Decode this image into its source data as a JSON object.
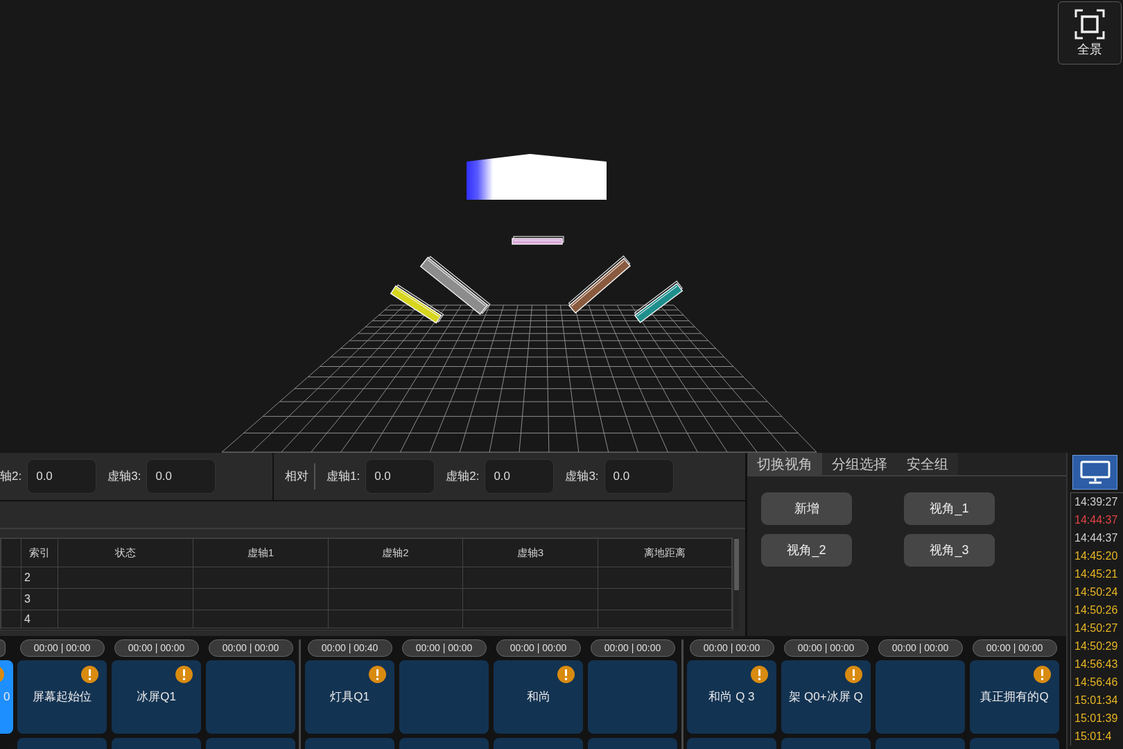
{
  "viewport": {
    "fixtures": [
      {
        "color": "#d6d61e"
      },
      {
        "color": "#8c8c8c"
      },
      {
        "color": "#d9a3d9"
      },
      {
        "color": "#8a5a3e"
      },
      {
        "color": "#1f8f8c"
      }
    ],
    "fullview_button": {
      "label": "全景"
    }
  },
  "axis_toolbar": {
    "sections": [
      {
        "fields": [
          {
            "label": "轴2:",
            "value": "0.0"
          },
          {
            "label": "虚轴3:",
            "value": "0.0"
          }
        ]
      },
      {
        "title": "相对",
        "fields": [
          {
            "label": "虚轴1:",
            "value": "0.0"
          },
          {
            "label": "虚轴2:",
            "value": "0.0"
          },
          {
            "label": "虚轴3:",
            "value": "0.0"
          }
        ]
      }
    ]
  },
  "table": {
    "columns": [
      "索引",
      "状态",
      "虚轴1",
      "虚轴2",
      "虚轴3",
      "离地距离"
    ],
    "rows": [
      {
        "index": "2"
      },
      {
        "index": "3"
      },
      {
        "index": "4"
      }
    ]
  },
  "view_panel": {
    "tabs": [
      {
        "label": "切换视角",
        "selected": true
      },
      {
        "label": "分组选择",
        "selected": false
      },
      {
        "label": "安全组",
        "selected": false
      }
    ],
    "buttons": [
      "新增",
      "视角_1",
      "视角_2",
      "视角_3"
    ]
  },
  "cues": {
    "groups": [
      {
        "columns": [
          {
            "kind": "partial",
            "tiles": [
              {
                "label": "0",
                "warning": true,
                "selected": true
              }
            ]
          },
          {
            "kind": "full",
            "time": "00:00 | 00:00",
            "tiles": [
              {
                "label": "屏幕起始位",
                "warning": true,
                "selected": false
              },
              {
                "warning": false,
                "selected": false
              }
            ]
          },
          {
            "kind": "full",
            "time": "00:00 | 00:00",
            "tiles": [
              {
                "label": "冰屏Q1",
                "warning": true,
                "selected": false
              },
              {
                "warning": false,
                "selected": false
              }
            ]
          },
          {
            "kind": "full",
            "time": "00:00 | 00:00",
            "tiles": [
              {
                "warning": false,
                "selected": false
              },
              {
                "warning": false,
                "selected": false
              }
            ]
          }
        ]
      },
      {
        "columns": [
          {
            "kind": "full",
            "time": "00:00 | 00:40",
            "tiles": [
              {
                "label": "灯具Q1",
                "warning": true,
                "selected": false
              },
              {
                "warning": false,
                "selected": false
              }
            ]
          },
          {
            "kind": "full",
            "time": "00:00 | 00:00",
            "tiles": [
              {
                "warning": false,
                "selected": false
              },
              {
                "warning": false,
                "selected": false
              }
            ]
          },
          {
            "kind": "full",
            "time": "00:00 | 00:00",
            "tiles": [
              {
                "label": "和尚",
                "warning": true,
                "selected": false
              },
              {
                "warning": false,
                "selected": false
              }
            ]
          },
          {
            "kind": "full",
            "time": "00:00 | 00:00",
            "tiles": [
              {
                "warning": false,
                "selected": false
              },
              {
                "warning": false,
                "selected": false
              }
            ]
          }
        ]
      },
      {
        "columns": [
          {
            "kind": "full",
            "time": "00:00 | 00:00",
            "tiles": [
              {
                "label": "和尚 Q 3",
                "warning": true,
                "selected": false
              },
              {
                "warning": false,
                "selected": false
              }
            ]
          },
          {
            "kind": "full",
            "time": "00:00 | 00:00",
            "tiles": [
              {
                "label": "架 Q0+冰屏 Q",
                "warning": true,
                "selected": false
              },
              {
                "warning": false,
                "selected": false
              }
            ]
          },
          {
            "kind": "full",
            "time": "00:00 | 00:00",
            "tiles": [
              {
                "warning": false,
                "selected": false
              },
              {
                "warning": false,
                "selected": false
              }
            ]
          },
          {
            "kind": "full",
            "time": "00:00 | 00:00",
            "tiles": [
              {
                "label": "真正拥有的Q",
                "warning": true,
                "selected": false
              },
              {
                "warning": false,
                "selected": false
              }
            ]
          }
        ]
      }
    ]
  },
  "log": {
    "monitor_selected": true,
    "entries": [
      {
        "time": "14:39:27",
        "color": "#cfcfcf"
      },
      {
        "time": "14:44:37",
        "color": "#e04444"
      },
      {
        "time": "14:44:37",
        "color": "#cfcfcf"
      },
      {
        "time": "14:45:20",
        "color": "#e8b624"
      },
      {
        "time": "14:45:21",
        "color": "#e8b624"
      },
      {
        "time": "14:50:24",
        "color": "#e8b624"
      },
      {
        "time": "14:50:26",
        "color": "#e8b624"
      },
      {
        "time": "14:50:27",
        "color": "#e8b624"
      },
      {
        "time": "14:50:29",
        "color": "#e8b624"
      },
      {
        "time": "14:56:43",
        "color": "#e8b624"
      },
      {
        "time": "14:56:46",
        "color": "#e8b624"
      },
      {
        "time": "15:01:34",
        "color": "#e8b624"
      },
      {
        "time": "15:01:39",
        "color": "#e8b624"
      },
      {
        "time": "15:01:4",
        "color": "#e8b624"
      }
    ]
  }
}
